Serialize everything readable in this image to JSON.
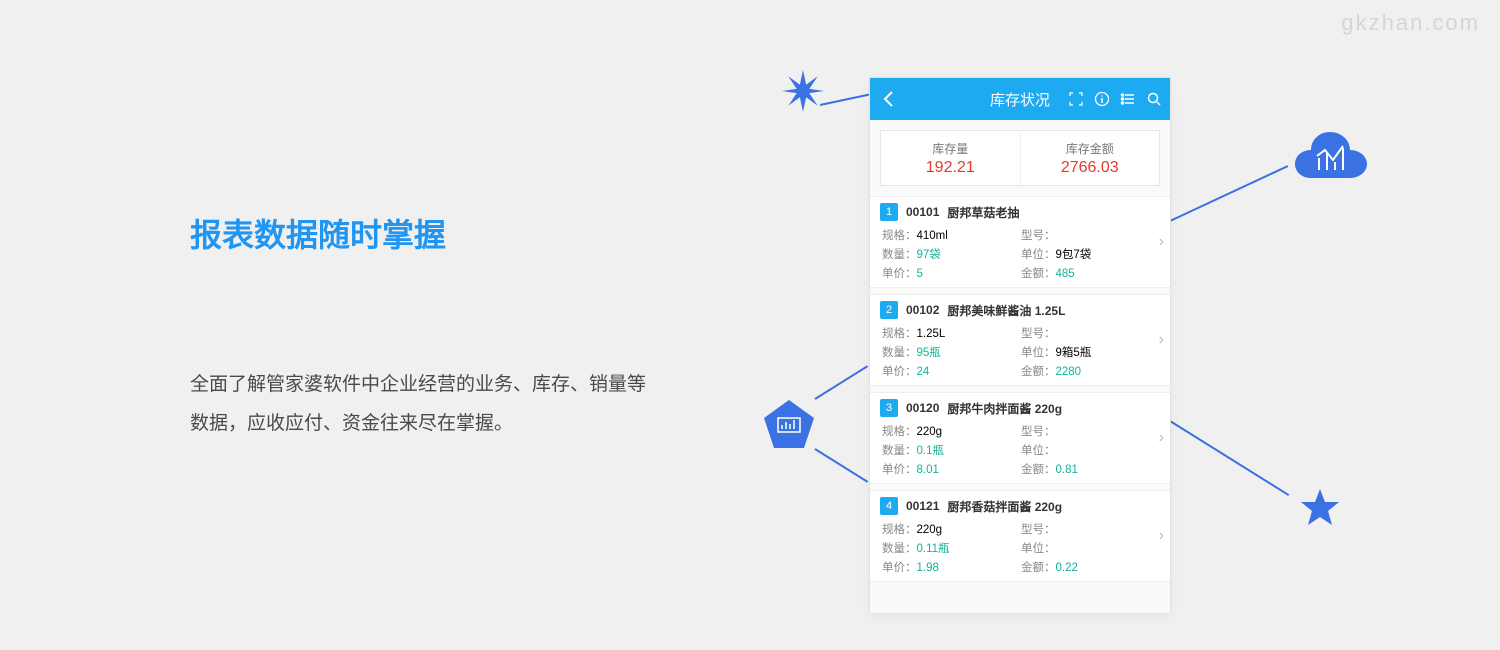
{
  "watermark": "gkzhan.com",
  "left": {
    "title": "报表数据随时掌握",
    "desc": "全面了解管家婆软件中企业经营的业务、库存、销量等数据，应收应付、资金往来尽在掌握。"
  },
  "phone": {
    "title": "库存状况",
    "summary": {
      "qty_label": "库存量",
      "qty_value": "192.21",
      "amt_label": "库存金额",
      "amt_value": "2766.03"
    },
    "labels": {
      "spec": "规格：",
      "model": "型号：",
      "qty": "数量：",
      "unit": "单位：",
      "price": "单价：",
      "amount": "金额："
    },
    "items": [
      {
        "idx": "1",
        "code": "00101",
        "name": "厨邦草菇老抽",
        "spec": "410ml",
        "model": "",
        "qty": "97袋",
        "unit": "9包7袋",
        "price": "5",
        "amount": "485"
      },
      {
        "idx": "2",
        "code": "00102",
        "name": "厨邦美味鲜酱油 1.25L",
        "spec": "1.25L",
        "model": "",
        "qty": "95瓶",
        "unit": "9箱5瓶",
        "price": "24",
        "amount": "2280"
      },
      {
        "idx": "3",
        "code": "00120",
        "name": "厨邦牛肉拌面酱 220g",
        "spec": "220g",
        "model": "",
        "qty": "0.1瓶",
        "unit": "",
        "price": "8.01",
        "amount": "0.81"
      },
      {
        "idx": "4",
        "code": "00121",
        "name": "厨邦香菇拌面酱 220g",
        "spec": "220g",
        "model": "",
        "qty": "0.11瓶",
        "unit": "",
        "price": "1.98",
        "amount": "0.22"
      }
    ]
  }
}
